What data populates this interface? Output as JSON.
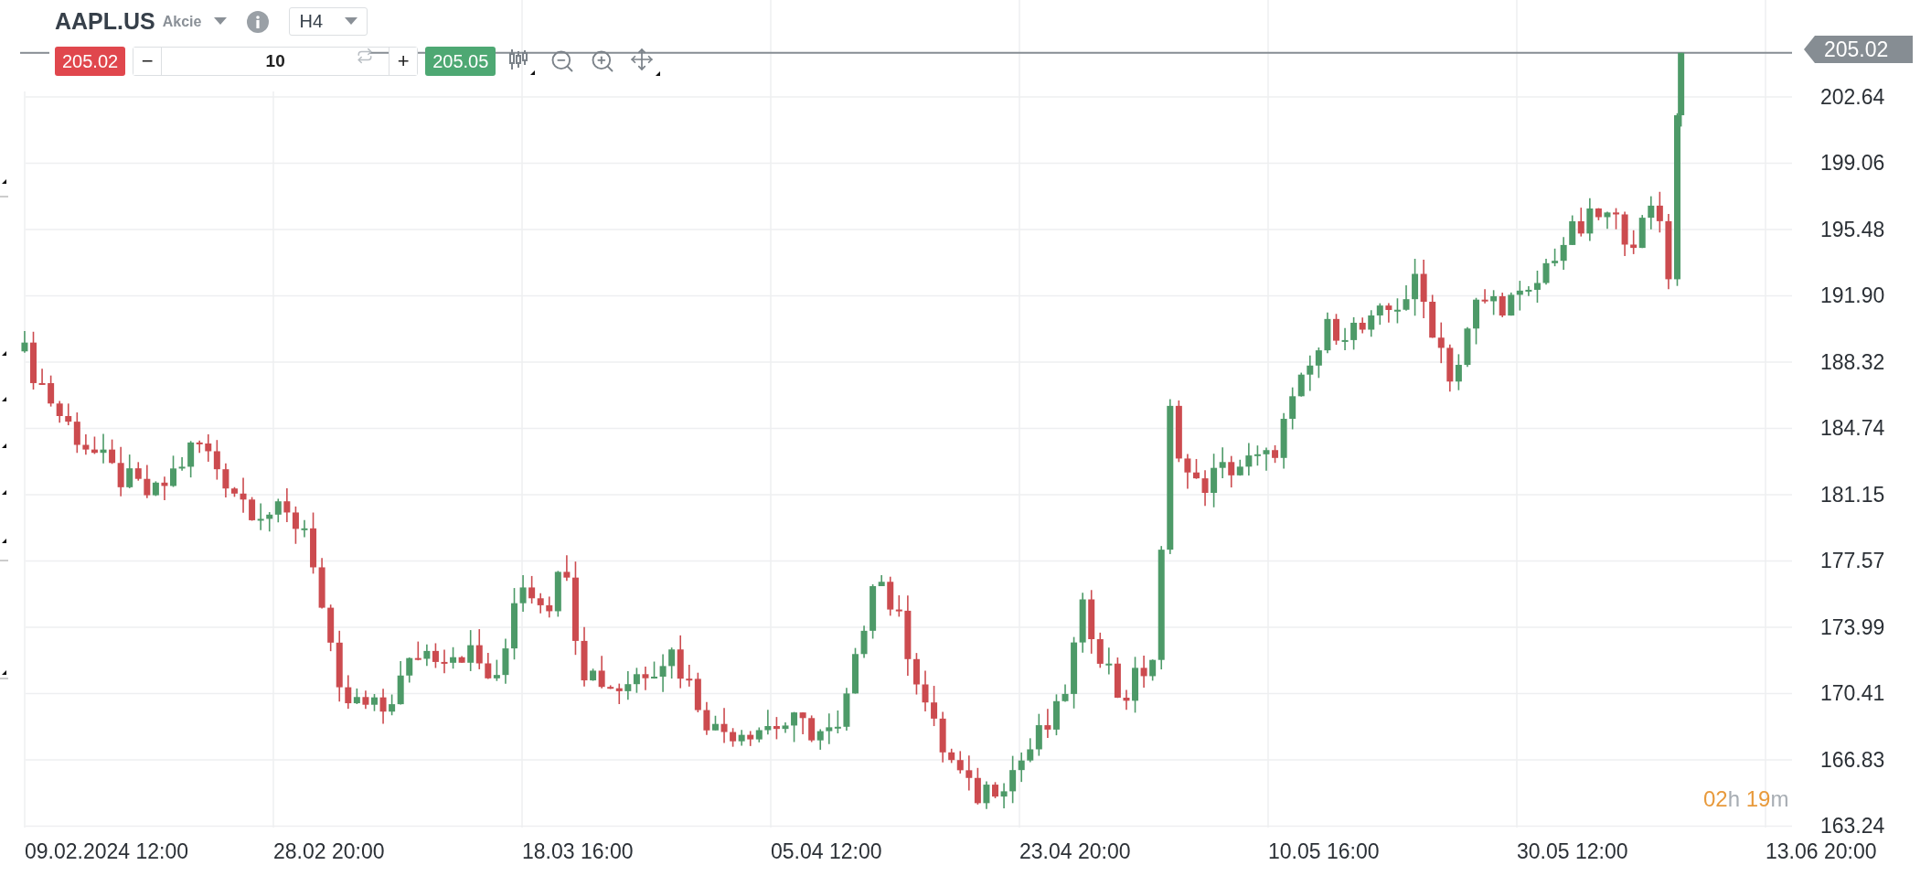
{
  "instrument": {
    "symbol": "AAPL.US",
    "type": "Akcie"
  },
  "timeframe": {
    "value": "H4"
  },
  "trade": {
    "sell_price": "205.02",
    "decrement": "−",
    "quantity": "10",
    "increment": "+",
    "buy_price": "205.05"
  },
  "last_price": "205.02",
  "price_axis": [
    "202.64",
    "199.06",
    "195.48",
    "191.90",
    "188.32",
    "184.74",
    "181.15",
    "177.57",
    "173.99",
    "170.41",
    "166.83",
    "163.24"
  ],
  "time_axis": [
    "09.02.2024 12:00",
    "28.02 20:00",
    "18.03 16:00",
    "05.04 12:00",
    "23.04 20:00",
    "10.05 16:00",
    "30.05 12:00",
    "13.06 20:00"
  ],
  "countdown": {
    "hours": "02",
    "hours_unit": "h",
    "minutes": "19",
    "minutes_unit": "m"
  }
}
